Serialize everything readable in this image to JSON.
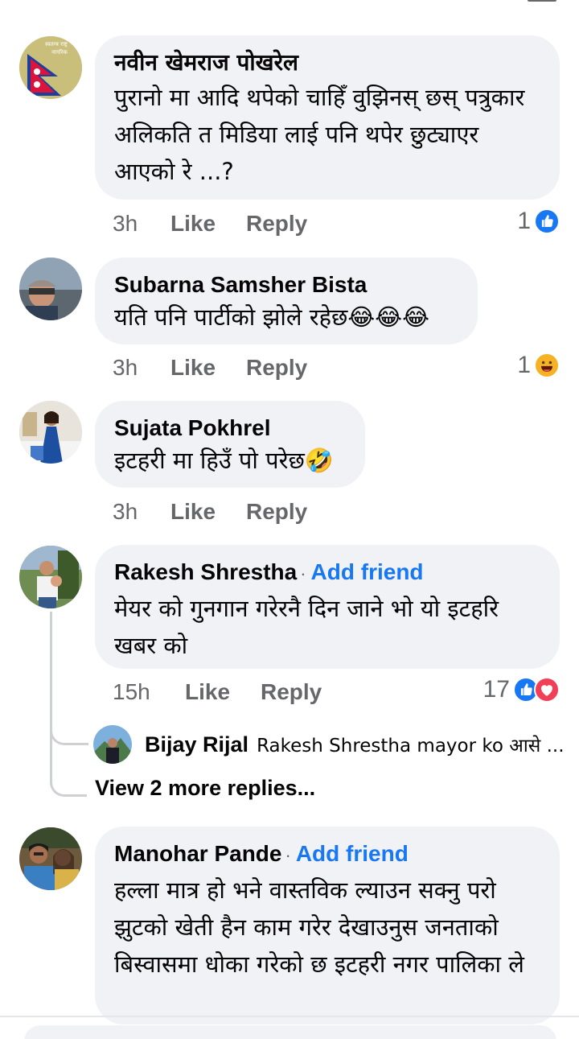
{
  "comments": [
    {
      "name": "नवीन खेमराज पोखरेल",
      "add_friend": "",
      "text": "पुरानो मा आदि थपेको चाहिँ वुझिनस् छस् पत्रुकार अलिकति त मिडिया  लाई पनि थपेर छुट्याएर आएको रे ...?",
      "time": "3h",
      "like": "Like",
      "reply": "Reply",
      "reaction_count": "1",
      "reactions": [
        "like-icon"
      ]
    },
    {
      "name": "Subarna Samsher Bista",
      "add_friend": "",
      "text": "यति पनि पार्टीको झोले रहेछ😂😂😂",
      "time": "3h",
      "like": "Like",
      "reply": "Reply",
      "reaction_count": "1",
      "reactions": [
        "haha-icon"
      ]
    },
    {
      "name": "Sujata Pokhrel",
      "add_friend": "",
      "text": "इटहरी मा हिउँ पो परेछ🤣",
      "time": "3h",
      "like": "Like",
      "reply": "Reply",
      "reaction_count": "",
      "reactions": []
    },
    {
      "name": "Rakesh Shrestha",
      "add_friend": "Add friend",
      "text": "मेयर को गुनगान गरेरनै दिन जाने भो यो इटहरि खबर को",
      "time": "15h",
      "like": "Like",
      "reply": "Reply",
      "reaction_count": "17",
      "reactions": [
        "like-icon",
        "love-icon"
      ]
    },
    {
      "name": "Manohar Pande",
      "add_friend": "Add friend",
      "text": "हल्ला मात्र हो भने वास्तविक ल्याउन सक्नु परो झुटको खेती हैन काम गरेर देखाउनुस जनताको बिस्वासमा धोका गरेको छ इटहरी नगर पालिका ले",
      "time": "",
      "like": "",
      "reply": "",
      "reaction_count": "",
      "reactions": []
    }
  ],
  "reply_preview": {
    "name": "Bijay Rijal",
    "text": "Rakesh Shrestha mayor ko आसे ..."
  },
  "view_more": "View 2 more replies...",
  "avatar_badge_text": [
    "स्वतन्त्र राष्ट्र",
    "नागरिक"
  ],
  "colors": {
    "bubble": "#f0f2f5",
    "accent": "#1877f2",
    "muted": "#65676b",
    "love": "#f33e58",
    "haha": "#f7b125"
  }
}
